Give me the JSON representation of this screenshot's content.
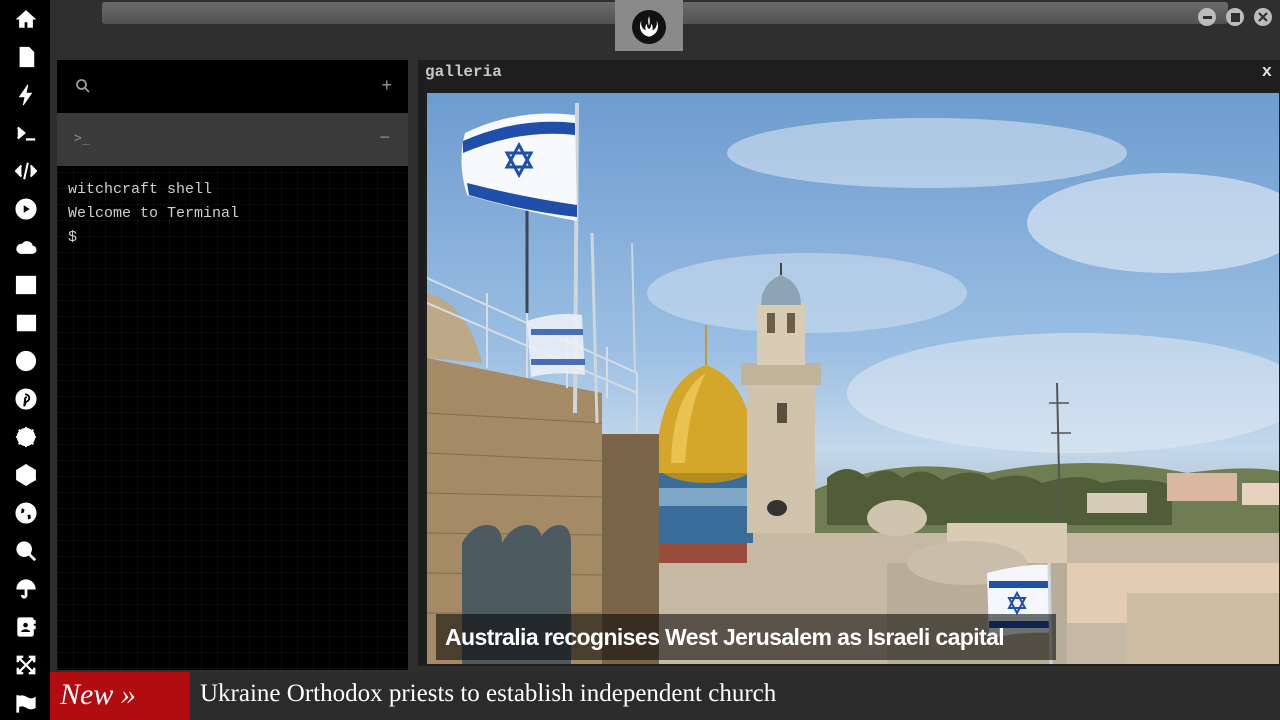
{
  "sidebar": {
    "icons": [
      "home-icon",
      "document-icon",
      "lightning-icon",
      "terminal-icon",
      "code-icon",
      "play-icon",
      "cloud-icon",
      "image-icon",
      "newspaper-icon",
      "wordpress-icon",
      "pinterest-icon",
      "helm-icon",
      "network-icon",
      "globe-icon",
      "search-icon",
      "umbrella-icon",
      "contacts-icon",
      "expand-icon",
      "flag-icon"
    ]
  },
  "topbar": {
    "logo": "rebel-alliance-icon"
  },
  "terminal": {
    "prompt_glyph": ">_",
    "lines": [
      "witchcraft shell",
      "Welcome to Terminal",
      "$"
    ]
  },
  "gallery": {
    "title": "galleria",
    "close": "x",
    "caption": "Australia recognises West Jerusalem as Israeli capital"
  },
  "ticker": {
    "badge": "New »",
    "headline": "Ukraine Orthodox priests to establish independent church"
  },
  "colors": {
    "ticker_badge": "#b10d10",
    "terminal_bg": "#000000",
    "panel_bg": "#1e1e1e",
    "frame_bg": "#2e2e2e"
  }
}
